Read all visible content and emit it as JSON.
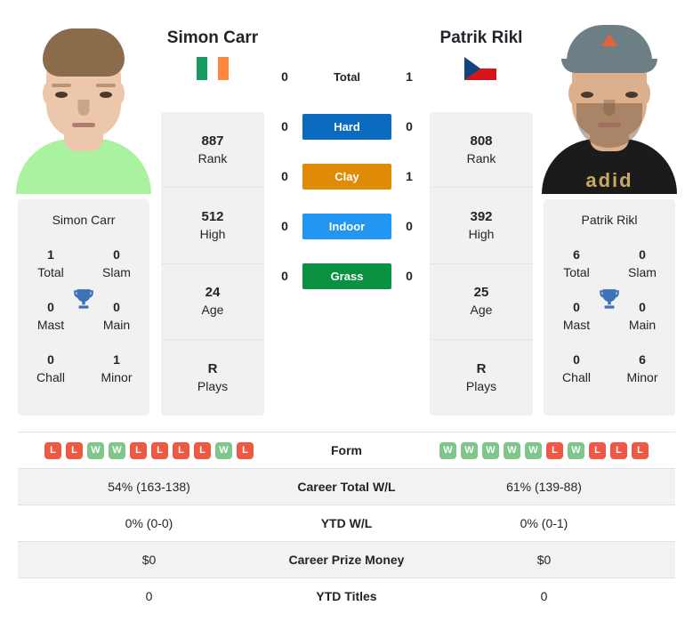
{
  "players": {
    "left": {
      "name": "Simon Carr",
      "flag": "ireland-flag",
      "card_name": "Simon Carr",
      "rank": {
        "value": "887",
        "label": "Rank"
      },
      "high": {
        "value": "512",
        "label": "High"
      },
      "age": {
        "value": "24",
        "label": "Age"
      },
      "plays": {
        "value": "R",
        "label": "Plays"
      },
      "titles": [
        {
          "value": "1",
          "label": "Total"
        },
        {
          "value": "0",
          "label": "Slam"
        },
        {
          "value": "0",
          "label": "Mast"
        },
        {
          "value": "0",
          "label": "Main"
        },
        {
          "value": "0",
          "label": "Chall"
        },
        {
          "value": "1",
          "label": "Minor"
        }
      ],
      "form": [
        "L",
        "L",
        "W",
        "W",
        "L",
        "L",
        "L",
        "L",
        "W",
        "L"
      ],
      "career_total_wl": "54% (163-138)",
      "ytd_wl": "0% (0-0)",
      "career_prize_money": "$0",
      "ytd_titles": "0"
    },
    "right": {
      "name": "Patrik Rikl",
      "flag": "czech-republic-flag",
      "card_name": "Patrik Rikl",
      "rank": {
        "value": "808",
        "label": "Rank"
      },
      "high": {
        "value": "392",
        "label": "High"
      },
      "age": {
        "value": "25",
        "label": "Age"
      },
      "plays": {
        "value": "R",
        "label": "Plays"
      },
      "titles": [
        {
          "value": "6",
          "label": "Total"
        },
        {
          "value": "0",
          "label": "Slam"
        },
        {
          "value": "0",
          "label": "Mast"
        },
        {
          "value": "0",
          "label": "Main"
        },
        {
          "value": "0",
          "label": "Chall"
        },
        {
          "value": "6",
          "label": "Minor"
        }
      ],
      "form": [
        "W",
        "W",
        "W",
        "W",
        "W",
        "L",
        "W",
        "L",
        "L",
        "L"
      ],
      "career_total_wl": "61% (139-88)",
      "ytd_wl": "0% (0-1)",
      "career_prize_money": "$0",
      "ytd_titles": "0"
    }
  },
  "head_to_head": [
    {
      "key": "total",
      "label": "Total",
      "left": "0",
      "right": "1",
      "color": "transparent",
      "text_color": "#212529"
    },
    {
      "key": "hard",
      "label": "Hard",
      "left": "0",
      "right": "0",
      "color": "#0b6cbf",
      "text_color": "#ffffff"
    },
    {
      "key": "clay",
      "label": "Clay",
      "left": "0",
      "right": "1",
      "color": "#e08b06",
      "text_color": "#ffffff"
    },
    {
      "key": "indoor",
      "label": "Indoor",
      "left": "0",
      "right": "0",
      "color": "#2196f3",
      "text_color": "#ffffff"
    },
    {
      "key": "grass",
      "label": "Grass",
      "left": "0",
      "right": "0",
      "color": "#0a9141",
      "text_color": "#ffffff"
    }
  ],
  "stats_rows": [
    {
      "key": "form",
      "label": "Form"
    },
    {
      "key": "career_total_wl",
      "label": "Career Total W/L"
    },
    {
      "key": "ytd_wl",
      "label": "YTD W/L"
    },
    {
      "key": "career_prize_money",
      "label": "Career Prize Money"
    },
    {
      "key": "ytd_titles",
      "label": "YTD Titles"
    }
  ],
  "colors": {
    "win_badge": "#7ec68a",
    "loss_badge": "#ef5844",
    "trophy": "#3d72b8",
    "card_bg": "#f1f1f1",
    "stripe_bg": "#f2f2f2",
    "ireland_green": "#169b62",
    "ireland_white": "#ffffff",
    "ireland_orange": "#ff883e",
    "czech_white": "#ffffff",
    "czech_red": "#d7141a",
    "czech_blue": "#11457e"
  },
  "photos": {
    "left": {
      "alt": "Simon Carr headshot",
      "hair": "#8a6b4a",
      "skin": "#edc7ab",
      "shirt": "#a9f2a0",
      "bg": "#ffffff"
    },
    "right": {
      "alt": "Patrik Rikl headshot",
      "hair": "#6b4f3a",
      "skin": "#dcb08c",
      "shirt": "#1b1b1b",
      "cap": "#6d7f85",
      "cap_logo": "#e2653a",
      "shirt_text": "adid",
      "shirt_text_color": "#c9a960",
      "bg": "#ffffff"
    }
  }
}
